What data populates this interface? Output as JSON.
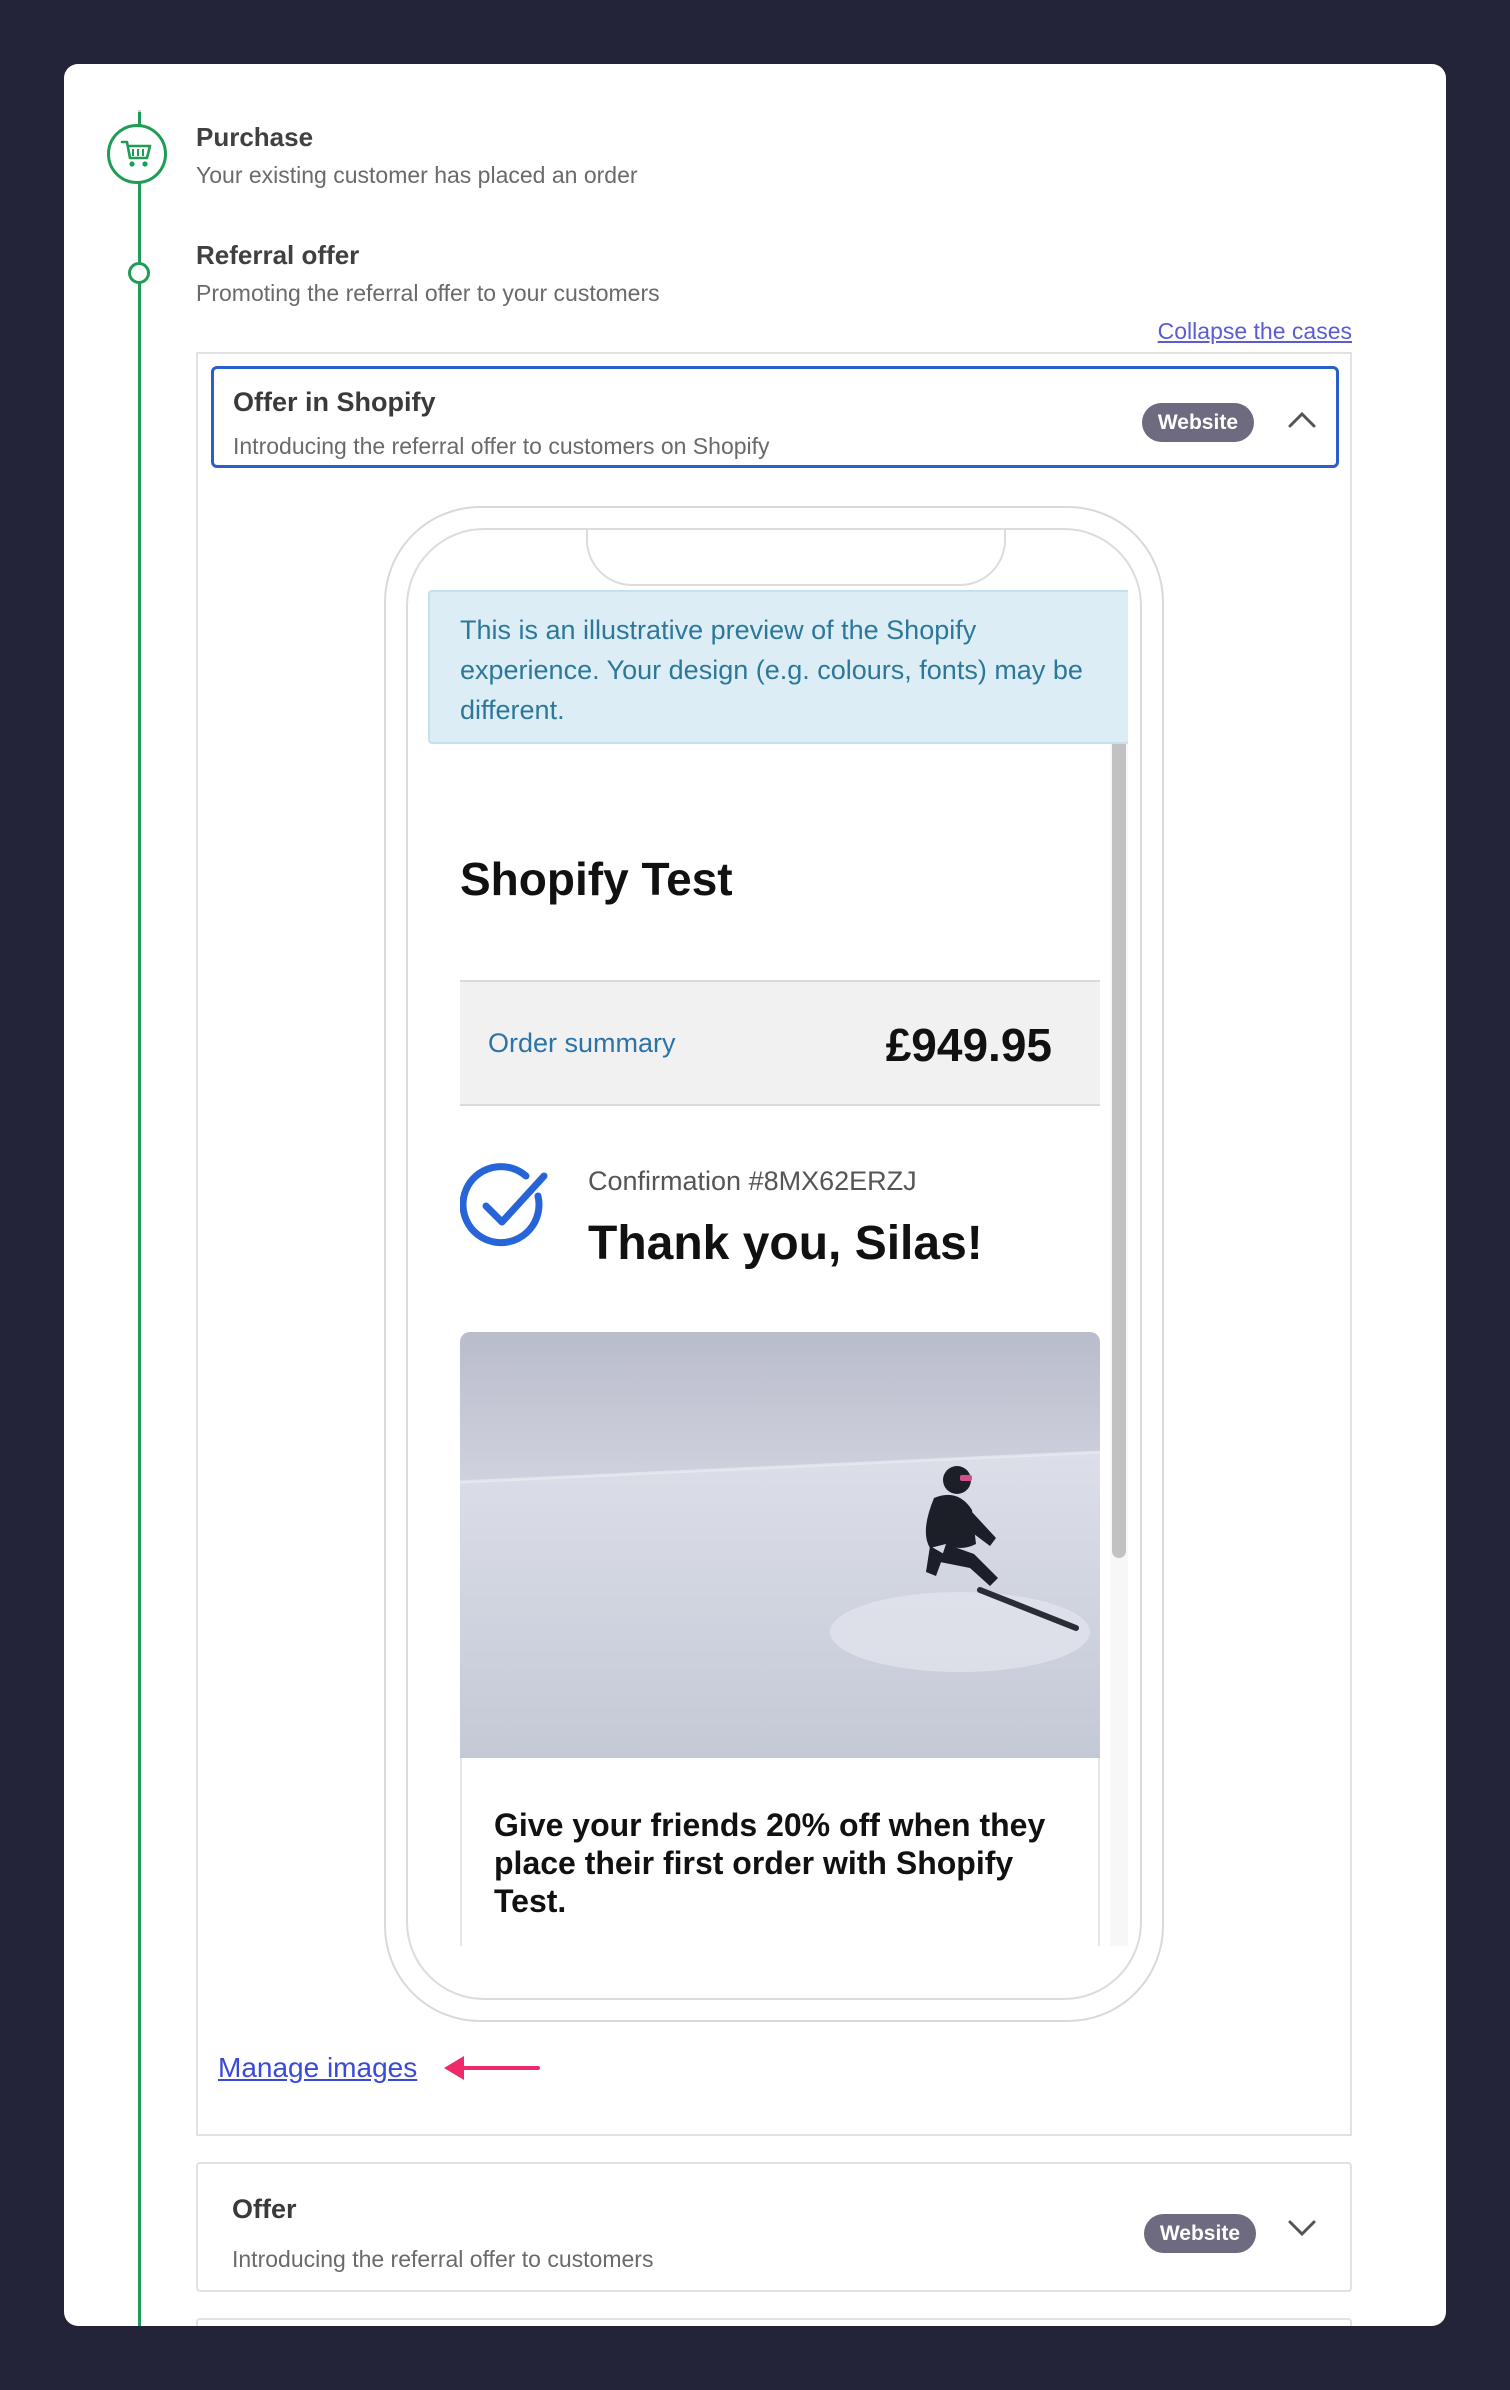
{
  "timeline": {
    "purchase": {
      "title": "Purchase",
      "description": "Your existing customer has placed an order"
    },
    "referral": {
      "title": "Referral offer",
      "description": "Promoting the referral offer to your customers"
    },
    "collapse_label": "Collapse the cases"
  },
  "cases": {
    "shopify": {
      "title": "Offer in Shopify",
      "description": "Introducing the referral offer to customers on Shopify",
      "badge": "Website"
    },
    "offer": {
      "title": "Offer",
      "description": "Introducing the referral offer to customers",
      "badge": "Website"
    }
  },
  "preview": {
    "notice": "This is an illustrative preview of the Shopify experience. Your design (e.g. colours, fonts) may be different.",
    "shop_name": "Shopify Test",
    "order_summary_label": "Order summary",
    "order_total": "£949.95",
    "confirmation": "Confirmation #8MX62ERZJ",
    "thanks": "Thank you, Silas!",
    "offer_text": "Give your friends 20% off when they place their first order with Shopify Test."
  },
  "manage_images_label": "Manage images",
  "colors": {
    "page_bg": "#23233a",
    "timeline_green": "#1f9d55",
    "focus_blue": "#2a5fc9",
    "badge_gray": "#6e6a80",
    "link_blue": "#3b4ad6",
    "arrow_pink": "#ee2a6b"
  },
  "icons": [
    "cart-icon",
    "chevron-up-icon",
    "chevron-down-icon",
    "check-circle-icon",
    "arrow-left-icon"
  ]
}
